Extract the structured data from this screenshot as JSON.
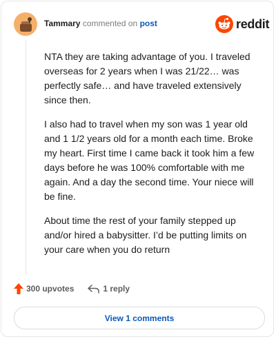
{
  "header": {
    "username": "Tammary",
    "action_text": "commented on",
    "link_text": "post",
    "brand": "reddit"
  },
  "comment": {
    "paragraphs": [
      "NTA they are taking advantage of you. I traveled overseas for 2 years when I was 21/22… was perfectly safe… and have traveled extensively since then.",
      "I also had to travel when my son was 1 year old and 1 1/2 years old for a month each time. Broke my heart. First time I came back it took him a few days before he was 100% comfortable with me again. And a day the second time. Your niece will be fine.",
      "About time the rest of your family stepped up and/or hired a babysitter. I’d be putting limits on your care when you do return"
    ]
  },
  "actions": {
    "upvotes": "300 upvotes",
    "replies": "1 reply",
    "view_comments": "View 1 comments"
  },
  "colors": {
    "accent_blue": "#0a58b8",
    "upvote_orange": "#ff4500",
    "reddit_orange": "#ff4500"
  },
  "icons": {
    "upvote": "upvote-arrow-icon",
    "reply": "reply-arrow-icon",
    "brand": "reddit-logo-icon"
  }
}
